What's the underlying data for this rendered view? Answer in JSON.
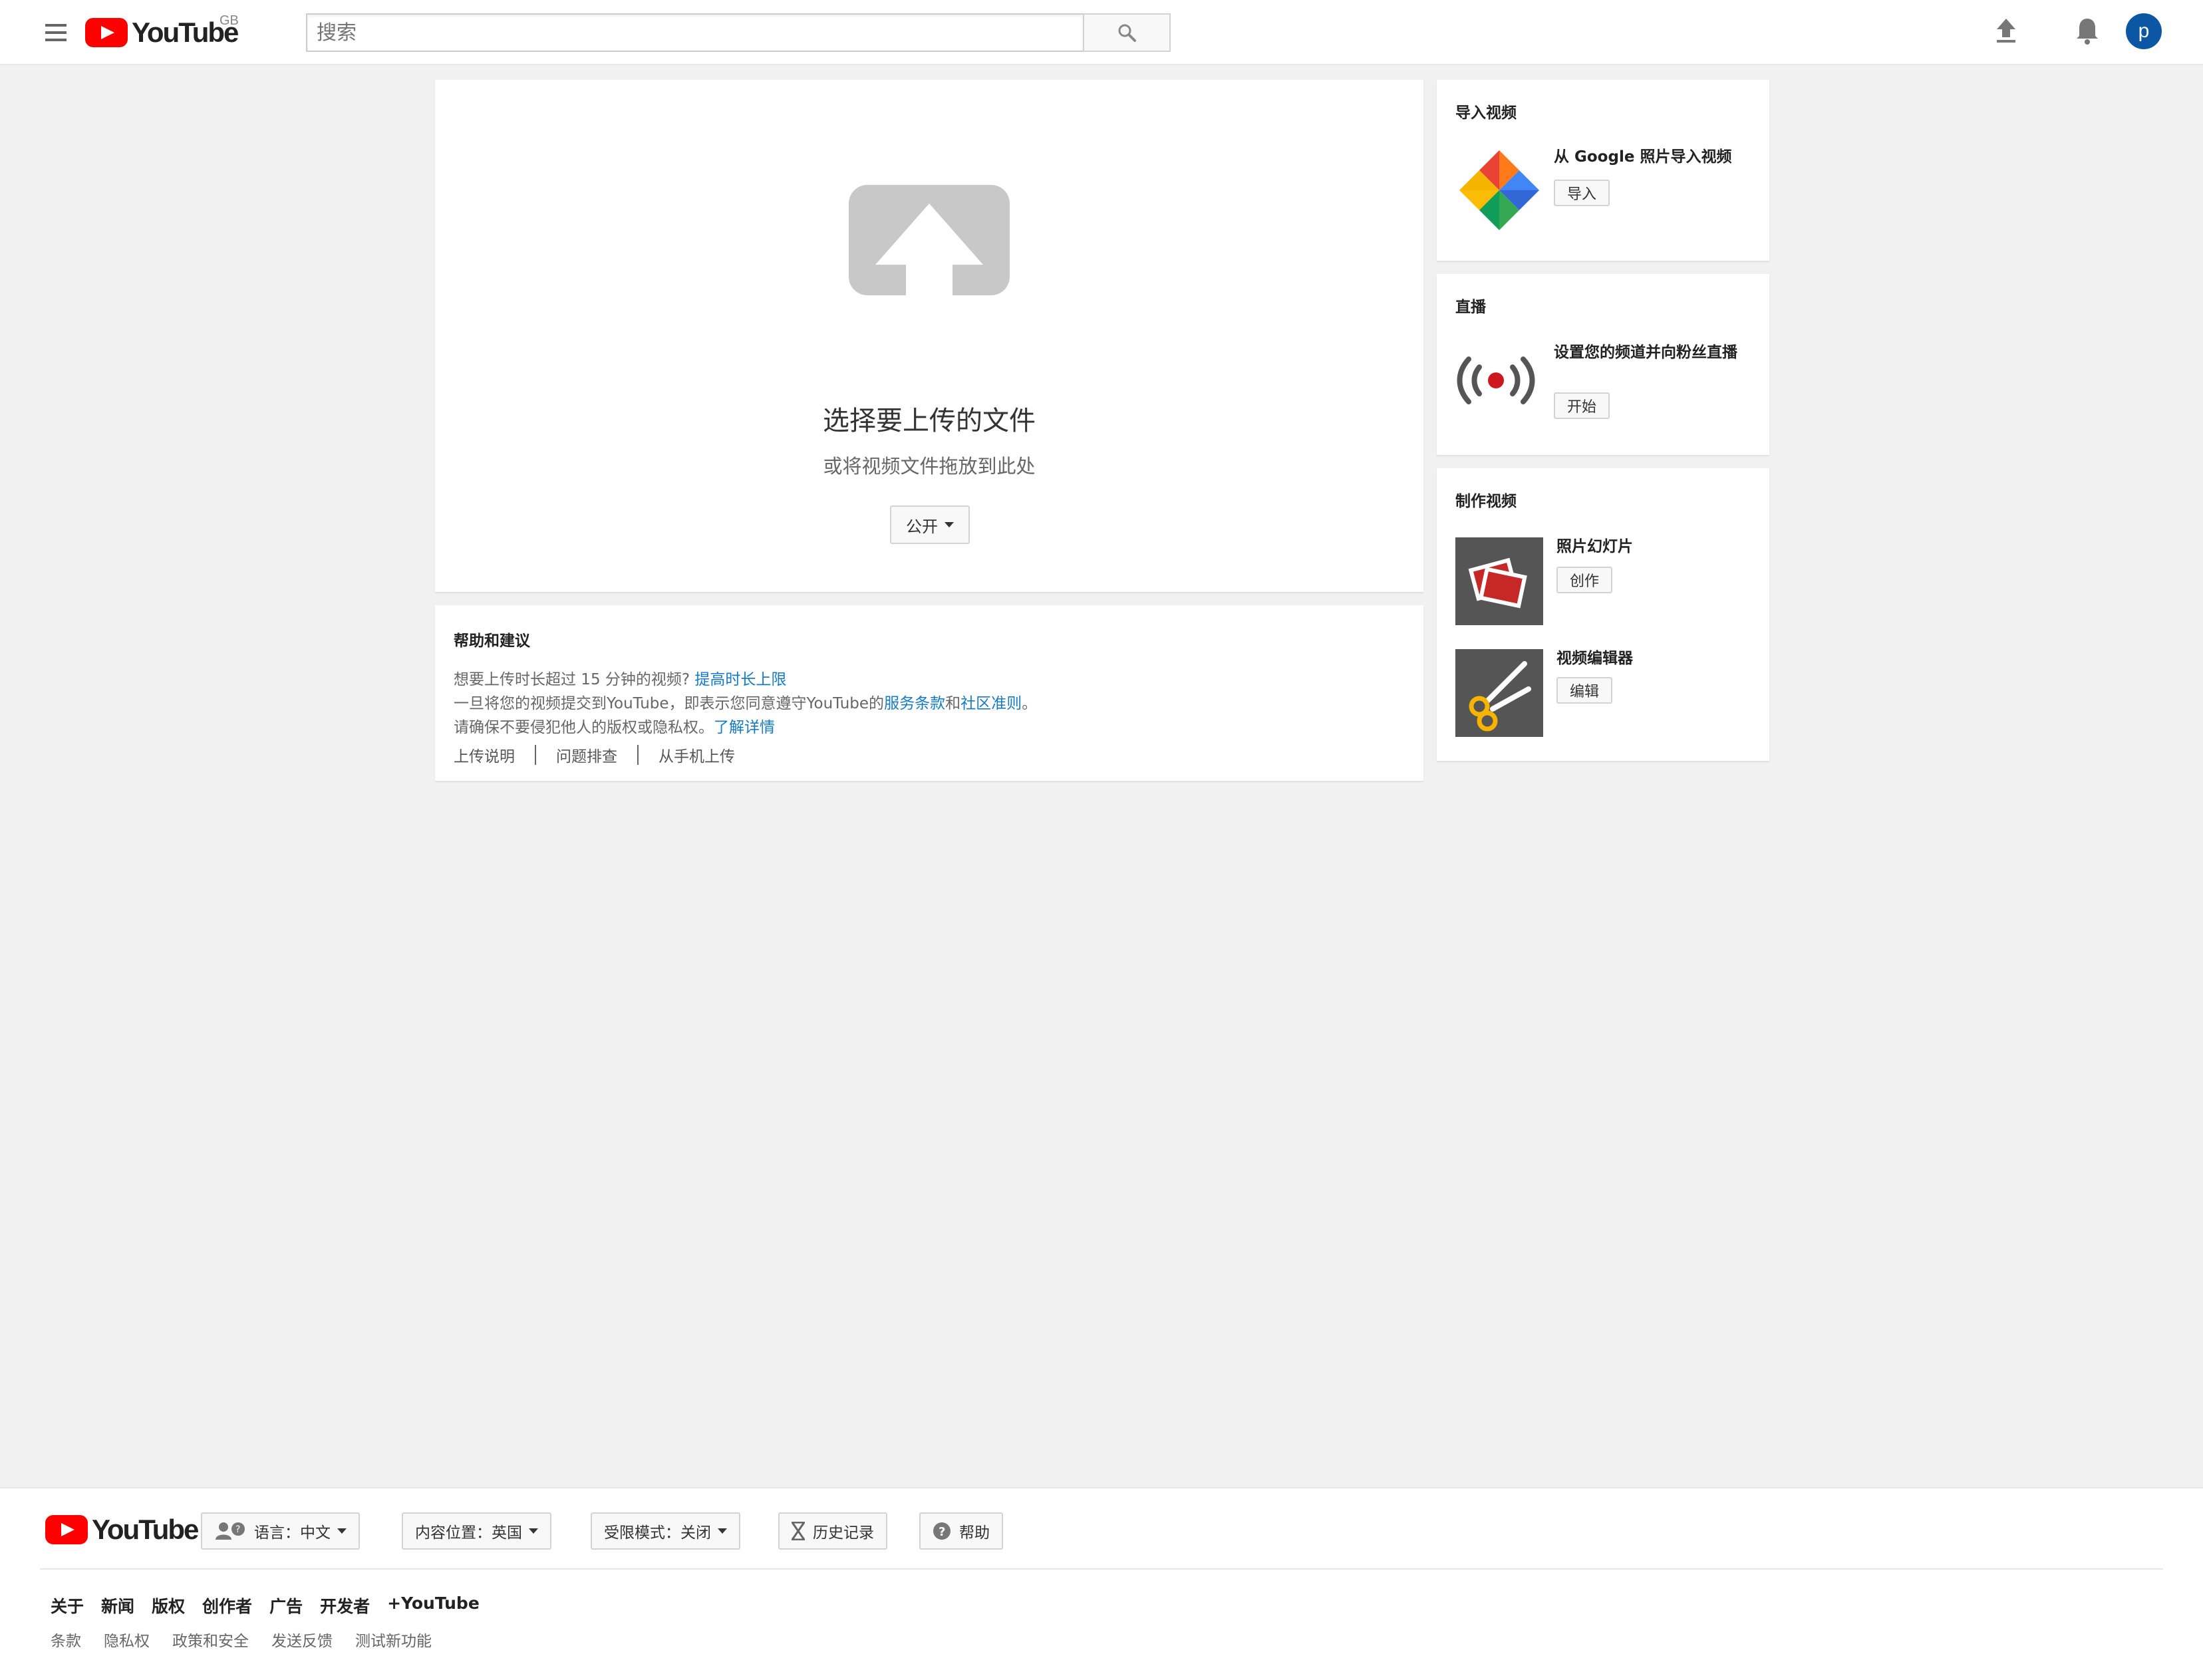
{
  "header": {
    "logo_text": "YouTube",
    "region": "GB",
    "search_placeholder": "搜索",
    "avatar_letter": "p"
  },
  "upload": {
    "title": "选择要上传的文件",
    "subtitle": "或将视频文件拖放到此处",
    "privacy_label": "公开"
  },
  "help": {
    "title": "帮助和建议",
    "line1_text": "想要上传时长超过 15 分钟的视频?",
    "line1_link": "提高时长上限",
    "line2_text": "一旦将您的视频提交到YouTube，即表示您同意遵守YouTube的",
    "line2_link1": "服务条款",
    "line2_and": "和",
    "line2_link2": "社区准则",
    "line2_end": "。",
    "line3_text": "请确保不要侵犯他人的版权或隐私权。",
    "line3_link": "了解详情",
    "links": [
      "上传说明",
      "问题排查",
      "从手机上传"
    ]
  },
  "sidebar": {
    "import": {
      "title": "导入视频",
      "desc": "从 Google 照片导入视频",
      "button": "导入"
    },
    "live": {
      "title": "直播",
      "desc": "设置您的频道并向粉丝直播",
      "button": "开始"
    },
    "create": {
      "title": "制作视频",
      "items": [
        {
          "label": "照片幻灯片",
          "button": "创作"
        },
        {
          "label": "视频编辑器",
          "button": "编辑"
        }
      ]
    }
  },
  "footer": {
    "logo_text": "YouTube",
    "language": "语言：中文",
    "location": "内容位置：英国",
    "restricted": "受限模式：关闭",
    "history": "历史记录",
    "help": "帮助",
    "primary_links": [
      "关于",
      "新闻",
      "版权",
      "创作者",
      "广告",
      "开发者",
      "+YouTube"
    ],
    "secondary_links": [
      "条款",
      "隐私权",
      "政策和安全",
      "发送反馈",
      "测试新功能"
    ]
  },
  "colors": {
    "brand_red": "#ff0000",
    "link_blue": "#167ac6",
    "avatar_blue": "#0b57a4",
    "page_bg": "#f1f1f1"
  }
}
